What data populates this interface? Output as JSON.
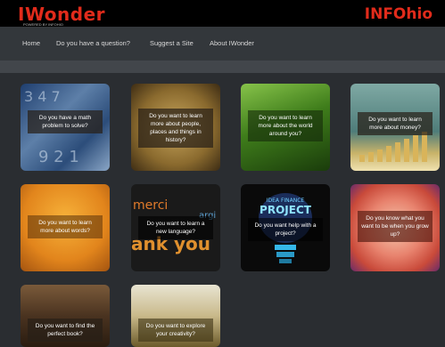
{
  "header": {
    "logo": "IWonder",
    "logo_tagline": "POWERED BY INFOHIO",
    "partner_logo": "INFOhio"
  },
  "nav": {
    "items": [
      "Home",
      "Do you have a question?",
      "Suggest a Site",
      "About IWonder"
    ]
  },
  "cards": [
    {
      "label": "Do you have a math problem to solve?"
    },
    {
      "label": "Do you want to learn more about people, places and things in history?"
    },
    {
      "label": "Do you want to learn more about the world around you?"
    },
    {
      "label": "Do you want to learn more about money?"
    },
    {
      "label": "Do you want to learn more about words?"
    },
    {
      "label": "Do you want to learn a new language?"
    },
    {
      "label": "Do you want help with a project?"
    },
    {
      "label": "Do you know what you want to be when you grow up?"
    },
    {
      "label": "Do you want to find the perfect book?"
    },
    {
      "label": "Do you want to explore your creativity?"
    }
  ],
  "card_images": {
    "numbers_text": "3 4 7 9 2 1",
    "words_text": "merci ank you argi",
    "project_text": "PROJECT",
    "project_small": "IDEA FINANCE"
  }
}
